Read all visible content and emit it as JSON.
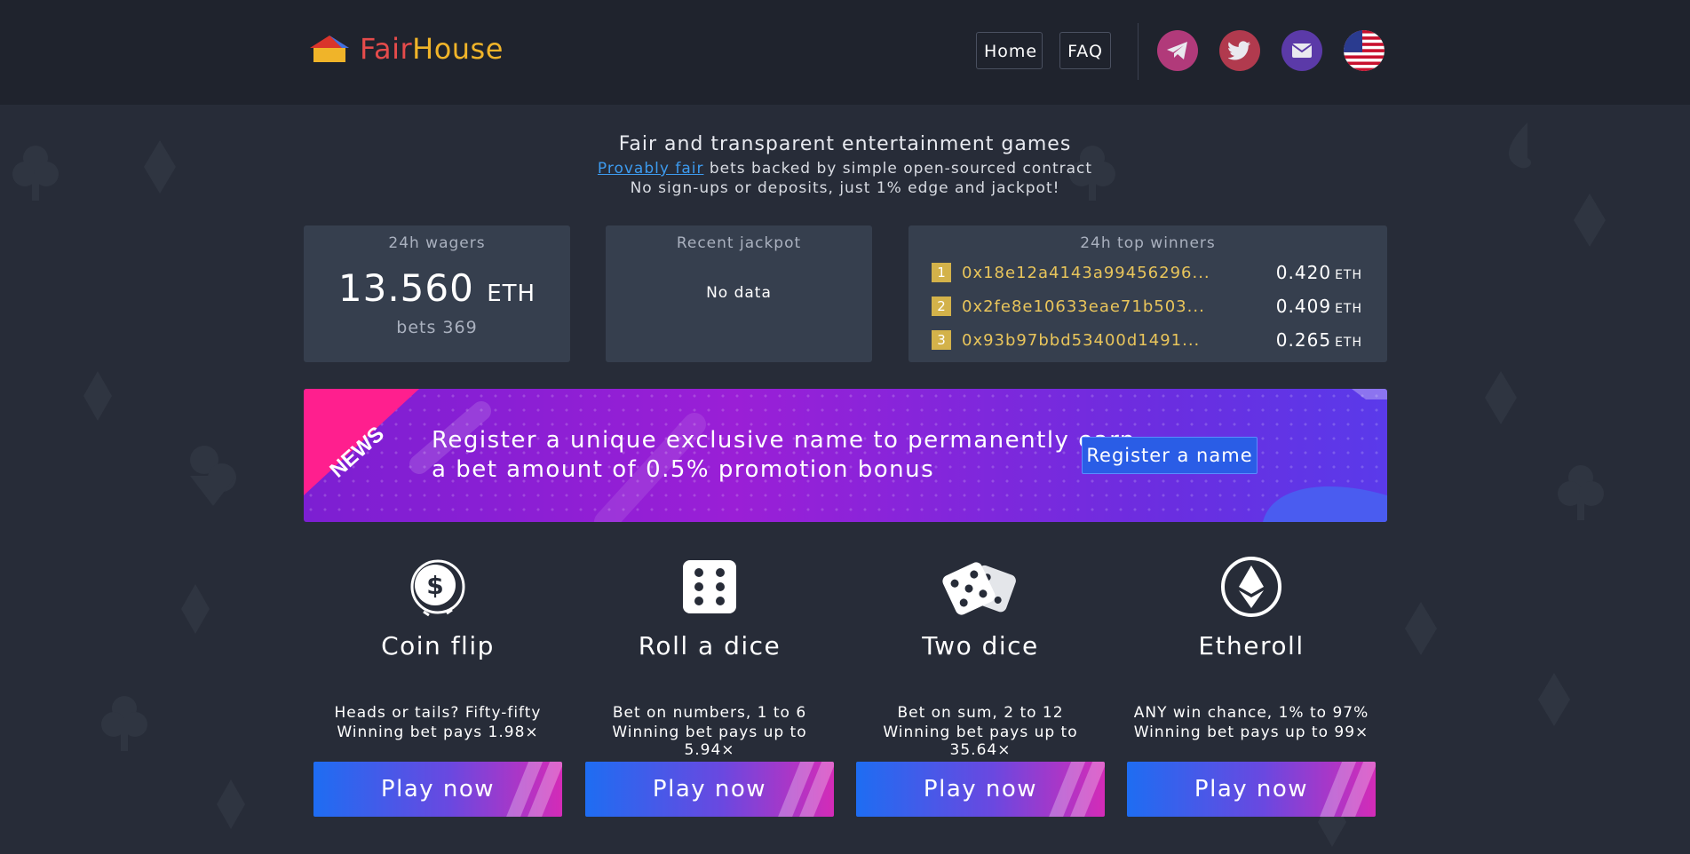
{
  "brand": {
    "fair": "Fair",
    "house": "House"
  },
  "nav": {
    "home": "Home",
    "faq": "FAQ"
  },
  "social": [
    {
      "icon": "telegram-icon",
      "color": "#b13a7a"
    },
    {
      "icon": "twitter-icon",
      "color": "#b13a4e"
    },
    {
      "icon": "email-icon",
      "color": "#5b3aa8"
    },
    {
      "icon": "us-flag-icon",
      "color": "#ffffff"
    }
  ],
  "hero": {
    "title": "Fair and transparent entertainment games",
    "link": "Provably fair",
    "line2_rest": " bets backed by simple open-sourced contract",
    "line3": "No sign-ups or deposits, just 1% edge and jackpot!"
  },
  "wagers": {
    "label": "24h wagers",
    "value": "13.560",
    "unit": "ETH",
    "bets": "bets 369"
  },
  "jackpot": {
    "label": "Recent jackpot",
    "value": "No data"
  },
  "winners": {
    "label": "24h top winners",
    "rows": [
      {
        "rank": "1",
        "address": "0x18e12a4143a99456296...",
        "amount": "0.420",
        "unit": "ETH"
      },
      {
        "rank": "2",
        "address": "0x2fe8e10633eae71b503...",
        "amount": "0.409",
        "unit": "ETH"
      },
      {
        "rank": "3",
        "address": "0x93b97bbd53400d1491...",
        "amount": "0.265",
        "unit": "ETH"
      }
    ]
  },
  "news": {
    "ribbon": "NEWS",
    "line1": "Register a unique exclusive name to permanently earn",
    "line2": "a bet amount of 0.5% promotion bonus",
    "button": "Register a name"
  },
  "games": [
    {
      "icon": "coin-flip-icon",
      "title": "Coin flip",
      "desc1": "Heads or tails? Fifty-fifty",
      "desc2": "Winning bet pays 1.98×",
      "button": "Play now"
    },
    {
      "icon": "dice-icon",
      "title": "Roll a dice",
      "desc1": "Bet on numbers, 1 to 6",
      "desc2": "Winning bet pays up to 5.94×",
      "button": "Play now"
    },
    {
      "icon": "two-dice-icon",
      "title": "Two dice",
      "desc1": "Bet on sum, 2 to 12",
      "desc2": "Winning bet pays up to 35.64×",
      "button": "Play now"
    },
    {
      "icon": "ethereum-icon",
      "title": "Etheroll",
      "desc1": "ANY win chance, 1% to 97%",
      "desc2": "Winning bet pays up to 99×",
      "button": "Play now"
    }
  ],
  "colors": {
    "accent_gold": "#e9c55b",
    "link": "#3d9bef",
    "card": "#363f4e",
    "background": "#272c38"
  }
}
